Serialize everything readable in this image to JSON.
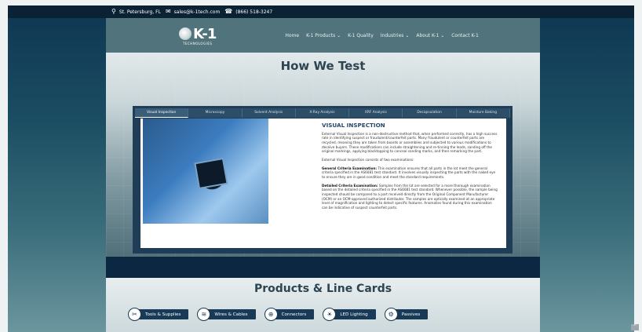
{
  "topbar": {
    "location": "St. Petersburg, FL",
    "email": "sales@k-1tech.com",
    "phone": "(866) 518-3247"
  },
  "header": {
    "logo": "K-1",
    "logo_sub": "TECHNOLOGIES",
    "nav": [
      {
        "label": "Home"
      },
      {
        "label": "K-1 Products ⌄"
      },
      {
        "label": "K-1 Quality"
      },
      {
        "label": "Industries ⌄"
      },
      {
        "label": "About K-1 ⌄"
      },
      {
        "label": "Contact K-1"
      }
    ]
  },
  "page_title": "How We Test",
  "tabs": [
    {
      "label": "Visual Inspection"
    },
    {
      "label": "Microscopy"
    },
    {
      "label": "Solvent Analysis"
    },
    {
      "label": "X-Ray Analysis"
    },
    {
      "label": "XRF Analysis"
    },
    {
      "label": "Decapsulation"
    },
    {
      "label": "Moisture Baking"
    }
  ],
  "content": {
    "heading": "VISUAL INSPECTION",
    "intro": "External Visual Inspection is a non-destructive method that, when performed correctly, has a high success rate in identifying suspect or fraudulent/counterfeit parts. Many fraudulent or counterfeit parts are recycled, meaning they are taken from boards or assemblies and subjected to various modifications to deceive buyers. These modifications can include straightening and re-tinning the leads, sanding off the original markings, applying blacktopping to conceal sanding marks, and then remarking the part.",
    "consists": "External Visual Inspection consists of two examinations:",
    "general_label": "General Criteria Examination:",
    "general_text": " This examination ensures that all parts in the lot meet the general criteria specified in the AS6081 test standard. It involves visually inspecting the parts with the naked eye to ensure they are in good condition and meet the standard requirements.",
    "detailed_label": "Detailed Criteria Examination:",
    "detailed_text": " Samples from the lot are selected for a more thorough examination based on the detailed criteria specified in the AS6081 test standard. Whenever possible, the sample being inspected should be compared to a part received directly from the Original Component Manufacturer (OCM) or an OCM-approved authorized distributor. The samples are optically examined at an appropriate level of magnification and lighting to detect specific features. Anomalies found during this examination can be indicative of suspect counterfeit parts."
  },
  "products": {
    "title": "Products & Line Cards",
    "cards": [
      {
        "label": "Tools & Supplies",
        "icon": "tools-icon"
      },
      {
        "label": "Wires & Cables",
        "icon": "cable-icon"
      },
      {
        "label": "Connectors",
        "icon": "connector-icon"
      },
      {
        "label": "LED Lighting",
        "icon": "bulb-icon"
      },
      {
        "label": "Passives",
        "icon": "passive-icon"
      }
    ]
  },
  "scroll_top": "^"
}
